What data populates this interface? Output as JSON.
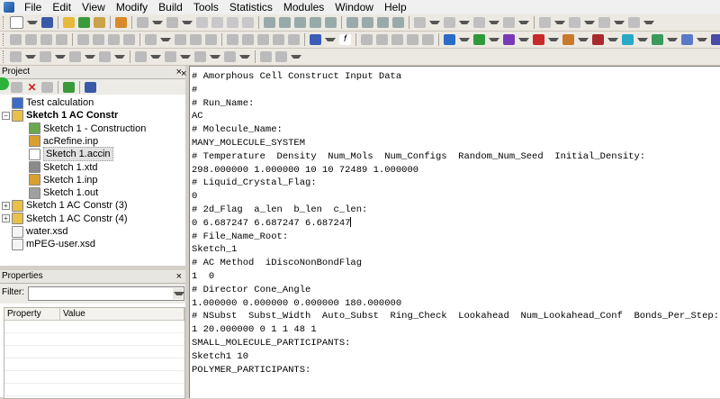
{
  "menu": [
    "File",
    "Edit",
    "View",
    "Modify",
    "Build",
    "Tools",
    "Statistics",
    "Modules",
    "Window",
    "Help"
  ],
  "project_panel": {
    "title": "Project",
    "close": "×",
    "tree": [
      {
        "label": "Test calculation",
        "level": 0,
        "icon": "project-icon",
        "expander": ""
      },
      {
        "label": "Sketch 1 AC Constr",
        "level": 0,
        "icon": "folder-icon",
        "expander": "−",
        "bold": true
      },
      {
        "label": "Sketch 1 - Construction",
        "level": 1,
        "icon": "chart-doc-icon",
        "expander": ""
      },
      {
        "label": "acRefine.inp",
        "level": 1,
        "icon": "input-file-icon",
        "expander": ""
      },
      {
        "label": "Sketch 1.accin",
        "level": 1,
        "icon": "text-file-icon",
        "expander": "",
        "selected": true
      },
      {
        "label": "Sketch 1.xtd",
        "level": 1,
        "icon": "trajectory-icon",
        "expander": ""
      },
      {
        "label": "Sketch 1.inp",
        "level": 1,
        "icon": "input-file-icon",
        "expander": ""
      },
      {
        "label": "Sketch 1.out",
        "level": 1,
        "icon": "output-file-icon",
        "expander": ""
      },
      {
        "label": "Sketch 1 AC Constr (3)",
        "level": 0,
        "icon": "folder-icon",
        "expander": "+"
      },
      {
        "label": "Sketch 1 AC Constr (4)",
        "level": 0,
        "icon": "folder-icon",
        "expander": "+"
      },
      {
        "label": "water.xsd",
        "level": 0,
        "icon": "structure-file-icon",
        "expander": ""
      },
      {
        "label": "mPEG-user.xsd",
        "level": 0,
        "icon": "structure-file-icon",
        "expander": ""
      }
    ]
  },
  "properties_panel": {
    "title": "Properties",
    "close": "×",
    "filter_label": "Filter:",
    "filter_value": "",
    "columns": [
      "Property",
      "Value"
    ]
  },
  "editor": {
    "close": "×",
    "lines": [
      "# Amorphous Cell Construct Input Data",
      "#",
      "# Run_Name:",
      "AC",
      "# Molecule_Name:",
      "MANY_MOLECULE_SYSTEM",
      "# Temperature  Density  Num_Mols  Num_Configs  Random_Num_Seed  Initial_Density:",
      "298.000000 1.000000 10 10 72489 1.000000",
      "# Liquid_Crystal_Flag:",
      "0",
      "# 2d_Flag  a_len  b_len  c_len:",
      "0 6.687247 6.687247 6.687247",
      "# File_Name_Root:",
      "Sketch_1",
      "# AC Method  iDiscoNonBondFlag",
      "1  0",
      "# Director Cone_Angle",
      "1.000000 0.000000 0.000000 180.000000",
      "# NSubst  Subst_Width  Auto_Subst  Ring_Check  Lookahead  Num_Lookahead_Conf  Bonds_Per_Step:",
      "1 20.000000 0 1 1 48 1",
      "SMALL_MOLECULE_PARTICIPANTS:",
      "Sketch1 10",
      "POLYMER_PARTICIPANTS:"
    ]
  },
  "colors": {
    "toolbar_bg": "#ece9e2",
    "selection_bg": "#e2e2e2",
    "accent_green": "#2db33a"
  }
}
